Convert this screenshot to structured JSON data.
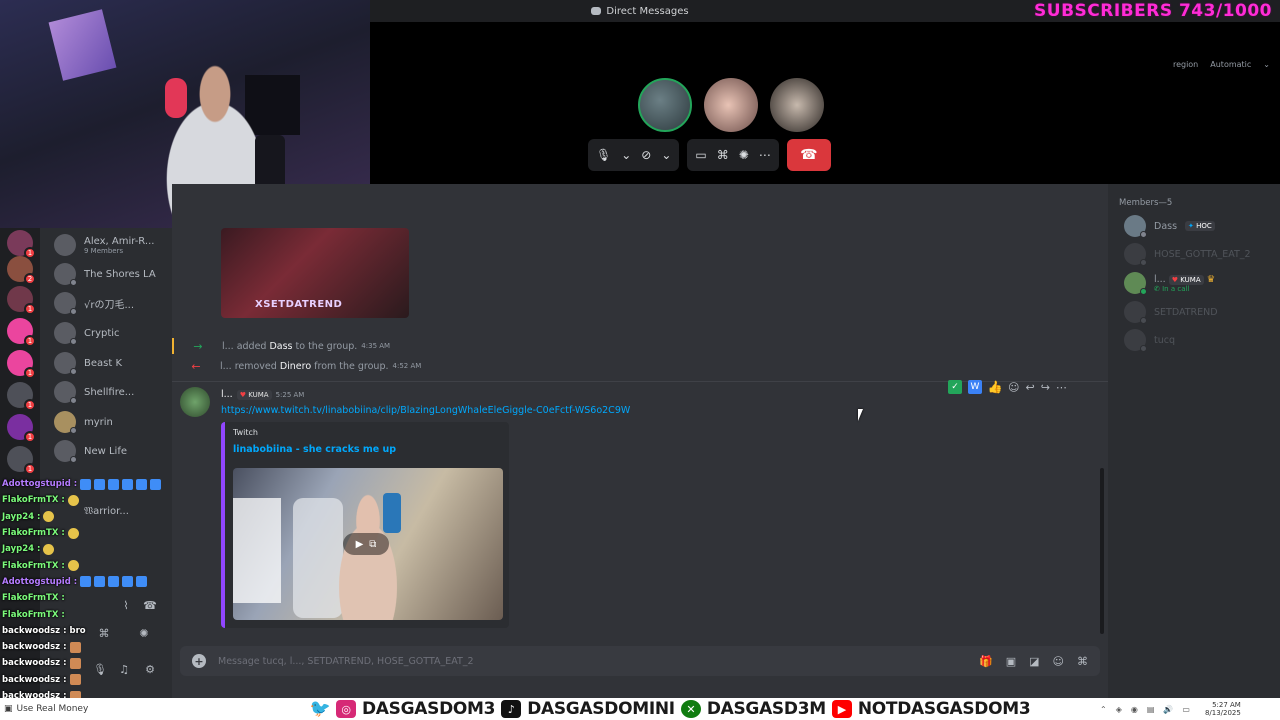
{
  "titlebar": {
    "title": "Direct Messages"
  },
  "overlay": {
    "subscribers": "SUBSCRIBERS 743/1000"
  },
  "call": {
    "region_label": "region",
    "region_value": "Automatic"
  },
  "servers": [
    {
      "badge": "1"
    },
    {
      "badge": "2"
    },
    {
      "badge": "1"
    },
    {
      "badge": "1"
    },
    {
      "badge": "1"
    },
    {
      "badge": "1"
    },
    {
      "badge": "1"
    },
    {
      "badge": "1"
    }
  ],
  "dms": [
    {
      "name": "Alex, Amir-R...",
      "sub": "9 Members"
    },
    {
      "name": "The Shores LA"
    },
    {
      "name": "√rの刀毛..."
    },
    {
      "name": "Cryptic"
    },
    {
      "name": "Beast K"
    },
    {
      "name": "Shellfire..."
    },
    {
      "name": "myrin"
    },
    {
      "name": "New Life"
    },
    {
      "name": "𝔚arrior..."
    }
  ],
  "stream_chat": [
    {
      "user": "Adottogstupid :",
      "color": "purple"
    },
    {
      "user": "FlakoFrmTX :",
      "color": "green"
    },
    {
      "user": "Jayp24 :",
      "color": "green"
    },
    {
      "user": "FlakoFrmTX :",
      "color": "green"
    },
    {
      "user": "Jayp24 :",
      "color": "green"
    },
    {
      "user": "FlakoFrmTX :",
      "color": "green"
    },
    {
      "user": "Adottogstupid :",
      "color": "purple"
    },
    {
      "user": "FlakoFrmTX :",
      "color": "green"
    },
    {
      "user": "FlakoFrmTX :",
      "color": "green"
    },
    {
      "user": "backwoodsz :",
      "color": "white",
      "text": "bro"
    },
    {
      "user": "backwoodsz :",
      "color": "white"
    },
    {
      "user": "backwoodsz :",
      "color": "white"
    },
    {
      "user": "backwoodsz :",
      "color": "white"
    },
    {
      "user": "backwoodsz :",
      "color": "white"
    }
  ],
  "main": {
    "embed_top_tag": "XSETDATREND",
    "system_messages": [
      {
        "actor": "l...",
        "verb": "added",
        "target": "Dass",
        "rest": "to the group.",
        "time": "4:35 AM"
      },
      {
        "actor": "l...",
        "verb": "removed",
        "target": "Dinero",
        "rest": "from the group.",
        "time": "4:52 AM"
      }
    ],
    "message": {
      "author": "l...",
      "tag": "KUMA",
      "time": "5:25 AM",
      "link": "https://www.twitch.tv/linabobiina/clip/BlazingLongWhaleEleGiggle-C0eFctf-WS6o2C9W",
      "embed_provider": "Twitch",
      "embed_title": "linabobiina - she cracks me up"
    },
    "composer_placeholder": "Message tucq, l..., SETDATREND, HOSE_GOTTA_EAT_2"
  },
  "members": {
    "header": "Members—5",
    "list": [
      {
        "name": "Dass",
        "tag": "HOC",
        "dim": false
      },
      {
        "name": "HOSE_GOTTA_EAT_2",
        "dim": true
      },
      {
        "name": "l...",
        "tag": "KUMA",
        "sub": "In a call",
        "dim": false
      },
      {
        "name": "SETDATREND",
        "dim": true
      },
      {
        "name": "tucq",
        "dim": true
      }
    ]
  },
  "banner": {
    "left_status": "Use Real Money",
    "twitter": "DASGASDOM3",
    "tiktok": "DASGASDOMINI",
    "xbox": "DASGASD3M",
    "youtube": "NOTDASGASDOM3",
    "time": "5:27 AM",
    "date": "8/13/2025"
  },
  "colors": {
    "accent_link": "#00a8fc",
    "hangup": "#da373c",
    "subscriber_overlay": "#ff2bd6",
    "online": "#23a55a"
  }
}
